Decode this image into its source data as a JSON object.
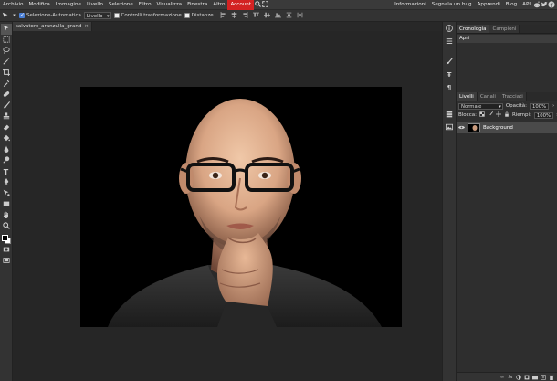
{
  "menubar": {
    "left": [
      "Archivio",
      "Modifica",
      "Immagine",
      "Livello",
      "Selezione",
      "Filtro",
      "Visualizza",
      "Finestra",
      "Altro"
    ],
    "account": "Account",
    "right": [
      "Informazioni",
      "Segnala un bug",
      "Apprendi",
      "Blog",
      "API"
    ],
    "accent_color": "#d32222"
  },
  "options": {
    "auto_select": "Selezione-Automatica",
    "auto_select_checked": true,
    "target": "Livello",
    "transform_controls": "Controlli trasformazione",
    "distances": "Distanze"
  },
  "document": {
    "tab_name": "salvatore_aranzulla_grand",
    "close": "×"
  },
  "history_panel": {
    "tabs": [
      "Cronologia",
      "Campioni"
    ],
    "items": [
      "Apri"
    ]
  },
  "layers_panel": {
    "tabs": [
      "Livelli",
      "Canali",
      "Tracciati"
    ],
    "blend_mode": "Normale",
    "opacity_label": "Opacità:",
    "opacity_value": "100%",
    "lock_label": "Blocca:",
    "fill_label": "Riempi:",
    "fill_value": "100%",
    "layers": [
      {
        "name": "Background",
        "visible": true
      }
    ]
  },
  "colors": {
    "foreground": "#000000",
    "background": "#ffffff"
  }
}
